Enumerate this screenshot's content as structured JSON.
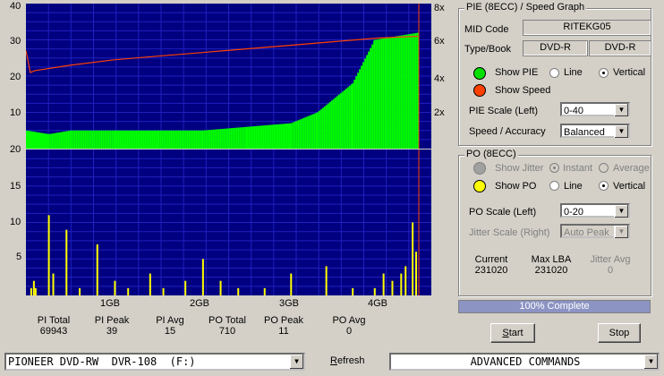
{
  "pie_graph": {
    "left_ticks": [
      "40",
      "30",
      "20",
      "10"
    ],
    "right_ticks": [
      "8x",
      "6x",
      "4x",
      "2x"
    ]
  },
  "po_graph": {
    "left_ticks": [
      "20",
      "15",
      "10",
      "5"
    ],
    "x_ticks": [
      "1GB",
      "2GB",
      "3GB",
      "4GB"
    ]
  },
  "chart_data": [
    {
      "type": "area",
      "title": "",
      "series": [
        {
          "name": "PIE",
          "color": "#00ff00"
        },
        {
          "name": "Speed",
          "color": "#ff4000"
        }
      ],
      "ylim_left": [
        0,
        40
      ],
      "ylim_right": [
        0,
        8
      ],
      "x": [
        0,
        0.25,
        0.5,
        1,
        1.5,
        2,
        2.5,
        3,
        3.3,
        3.7,
        3.95,
        4.45
      ],
      "pie_values": [
        5,
        4,
        5,
        5,
        5,
        5,
        6,
        7,
        10,
        18,
        30,
        32
      ],
      "speed_x": [
        0,
        0.05,
        0.1,
        0.5,
        1,
        1.5,
        2,
        2.5,
        3,
        3.5,
        4,
        4.45
      ],
      "speed_values": [
        5.4,
        4.2,
        4.3,
        4.6,
        4.9,
        5.1,
        5.3,
        5.5,
        5.7,
        5.9,
        6.1,
        6.2
      ]
    },
    {
      "type": "bar",
      "title": "",
      "series": [
        {
          "name": "PO",
          "color": "#ffff00"
        }
      ],
      "ylim": [
        0,
        20
      ],
      "x": [
        0.05,
        0.08,
        0.1,
        0.25,
        0.3,
        0.45,
        0.6,
        0.8,
        1.0,
        1.15,
        1.4,
        1.55,
        1.8,
        2.0,
        2.2,
        2.4,
        2.7,
        3.0,
        3.4,
        3.7,
        3.95,
        4.05,
        4.15,
        4.25,
        4.3,
        4.38,
        4.42
      ],
      "values": [
        1,
        2,
        1,
        11,
        3,
        9,
        1,
        7,
        2,
        1,
        3,
        1,
        2,
        5,
        2,
        1,
        1,
        3,
        4,
        1,
        1,
        3,
        2,
        3,
        4,
        10,
        6
      ]
    }
  ],
  "pie_section": {
    "title": "PIE (8ECC) / Speed Graph",
    "mid_label": "MID Code",
    "mid_value": "RITEKG05",
    "type_label": "Type/Book",
    "type_value": "DVD-R",
    "book_value": "DVD-R",
    "show_pie": "Show PIE",
    "show_speed": "Show Speed",
    "line": "Line",
    "vertical": "Vertical",
    "scale_label": "PIE Scale (Left)",
    "scale_value": "0-40",
    "speed_label": "Speed / Accuracy",
    "speed_value": "Balanced"
  },
  "po_section": {
    "title": "PO (8ECC)",
    "show_jitter": "Show Jitter",
    "instant": "Instant",
    "average": "Average",
    "show_po": "Show PO",
    "line": "Line",
    "vertical": "Vertical",
    "scale_label": "PO Scale (Left)",
    "scale_value": "0-20",
    "jitter_label": "Jitter Scale (Right)",
    "jitter_value": "Auto Peak",
    "current_label": "Current",
    "current_value": "231020",
    "maxlba_label": "Max LBA",
    "maxlba_value": "231020",
    "jitteravg_label": "Jitter Avg",
    "jitteravg_value": "0"
  },
  "progress": {
    "text": "100% Complete",
    "fraction": 1.0
  },
  "stats": [
    {
      "label": "PI Total",
      "value": "69943"
    },
    {
      "label": "PI Peak",
      "value": "39"
    },
    {
      "label": "PI Avg",
      "value": "15"
    },
    {
      "label": "PO Total",
      "value": "710"
    },
    {
      "label": "PO Peak",
      "value": "11"
    },
    {
      "label": "PO Avg",
      "value": "0"
    }
  ],
  "buttons": {
    "start_pre": "",
    "start_u": "S",
    "start_post": "tart",
    "stop": "Stop"
  },
  "bottom": {
    "drive": "PIONEER DVD-RW  DVR-108  (F:)",
    "refresh_u": "R",
    "refresh_rest": "efresh",
    "commands": "ADVANCED COMMANDS"
  }
}
